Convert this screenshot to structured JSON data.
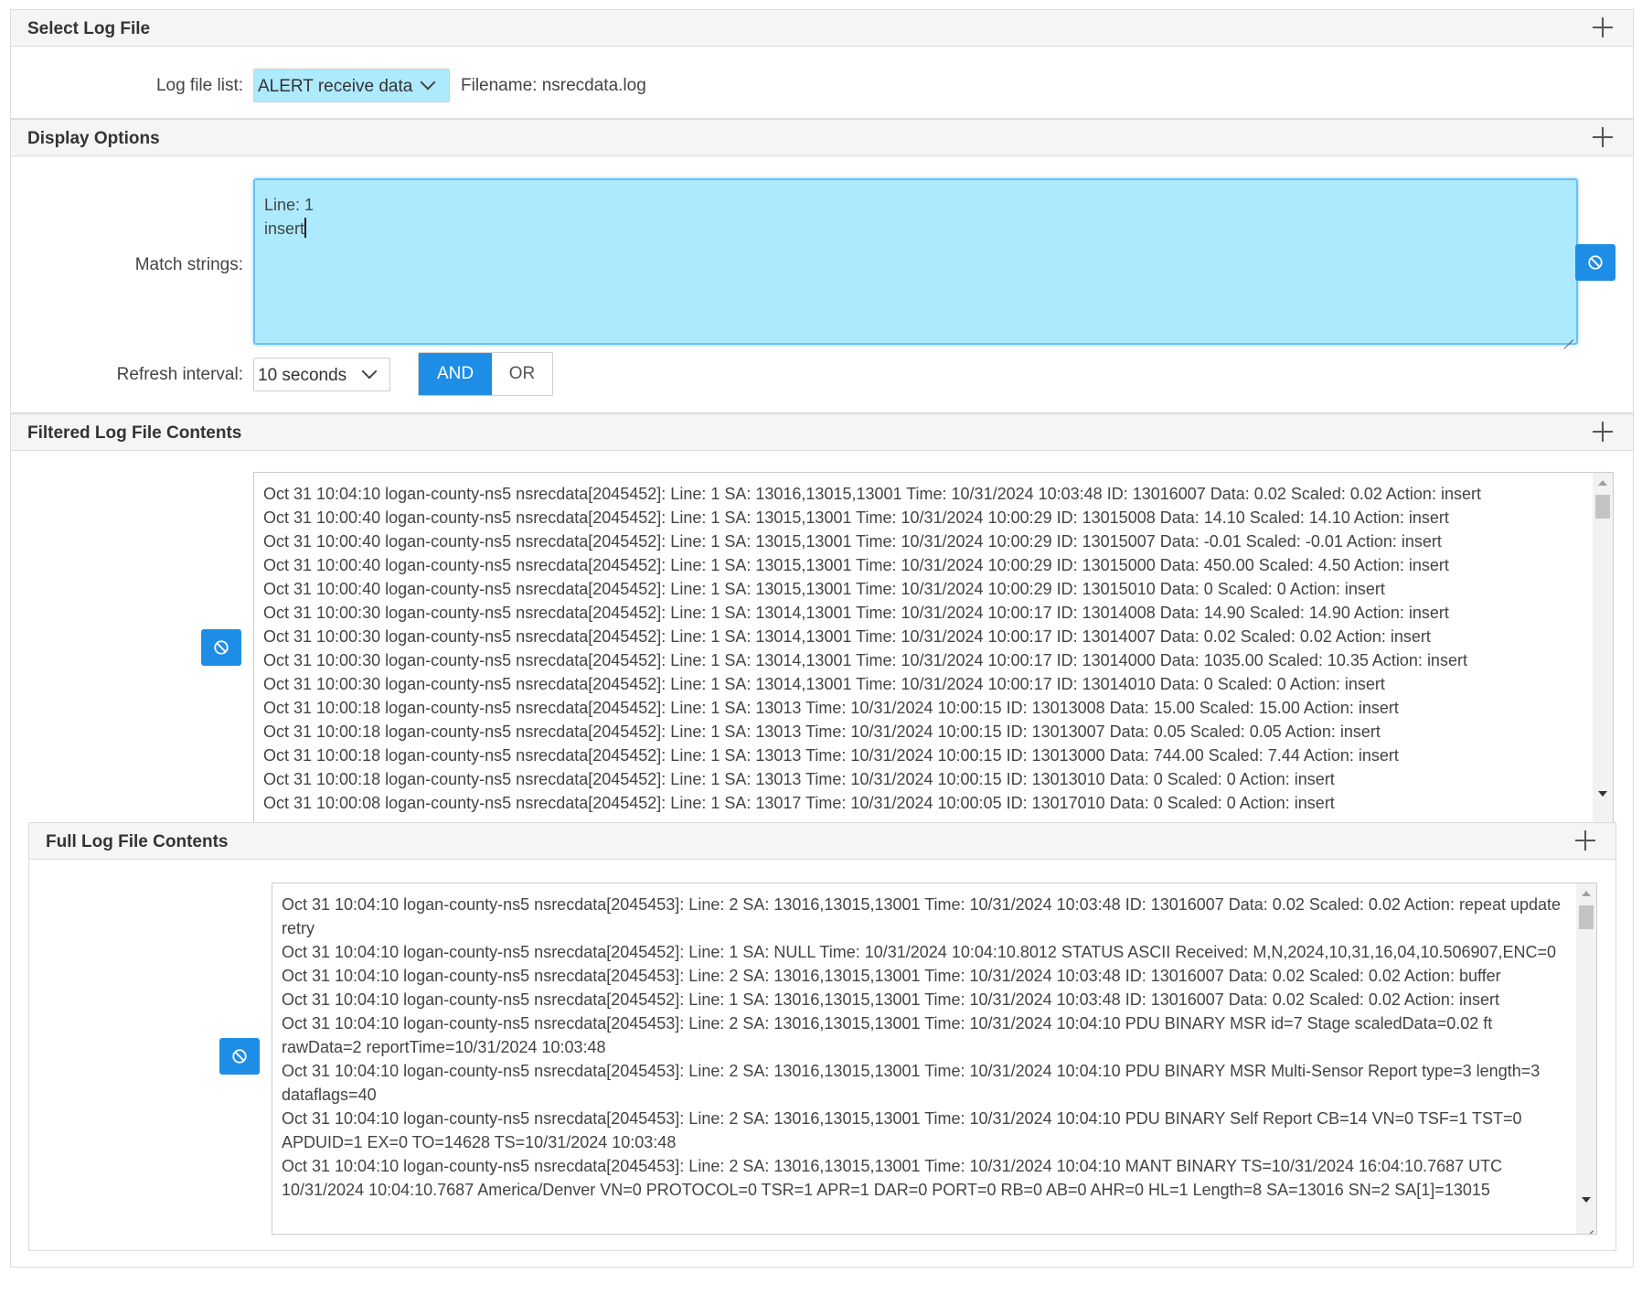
{
  "select_panel": {
    "title": "Select Log File",
    "log_file_label": "Log file list:",
    "log_file_value": "ALERT receive data",
    "filename_text": "Filename: nsrecdata.log"
  },
  "display_panel": {
    "title": "Display Options",
    "match_label": "Match strings:",
    "match_lines": [
      "Line: 1",
      "insert"
    ],
    "refresh_label": "Refresh interval:",
    "refresh_value": "10 seconds",
    "and_label": "AND",
    "or_label": "OR",
    "active_mode": "AND"
  },
  "filtered_panel": {
    "title": "Filtered Log File Contents",
    "lines": [
      "Oct 31 10:04:10 logan-county-ns5 nsrecdata[2045452]: Line: 1 SA: 13016,13015,13001 Time: 10/31/2024 10:03:48 ID: 13016007 Data: 0.02 Scaled: 0.02 Action: insert",
      "Oct 31 10:00:40 logan-county-ns5 nsrecdata[2045452]: Line: 1 SA: 13015,13001 Time: 10/31/2024 10:00:29 ID: 13015008 Data: 14.10 Scaled: 14.10 Action: insert",
      "Oct 31 10:00:40 logan-county-ns5 nsrecdata[2045452]: Line: 1 SA: 13015,13001 Time: 10/31/2024 10:00:29 ID: 13015007 Data: -0.01 Scaled: -0.01 Action: insert",
      "Oct 31 10:00:40 logan-county-ns5 nsrecdata[2045452]: Line: 1 SA: 13015,13001 Time: 10/31/2024 10:00:29 ID: 13015000 Data: 450.00 Scaled: 4.50 Action: insert",
      "Oct 31 10:00:40 logan-county-ns5 nsrecdata[2045452]: Line: 1 SA: 13015,13001 Time: 10/31/2024 10:00:29 ID: 13015010 Data: 0 Scaled: 0 Action: insert",
      "Oct 31 10:00:30 logan-county-ns5 nsrecdata[2045452]: Line: 1 SA: 13014,13001 Time: 10/31/2024 10:00:17 ID: 13014008 Data: 14.90 Scaled: 14.90 Action: insert",
      "Oct 31 10:00:30 logan-county-ns5 nsrecdata[2045452]: Line: 1 SA: 13014,13001 Time: 10/31/2024 10:00:17 ID: 13014007 Data: 0.02 Scaled: 0.02 Action: insert",
      "Oct 31 10:00:30 logan-county-ns5 nsrecdata[2045452]: Line: 1 SA: 13014,13001 Time: 10/31/2024 10:00:17 ID: 13014000 Data: 1035.00 Scaled: 10.35 Action: insert",
      "Oct 31 10:00:30 logan-county-ns5 nsrecdata[2045452]: Line: 1 SA: 13014,13001 Time: 10/31/2024 10:00:17 ID: 13014010 Data: 0 Scaled: 0 Action: insert",
      "Oct 31 10:00:18 logan-county-ns5 nsrecdata[2045452]: Line: 1 SA: 13013 Time: 10/31/2024 10:00:15 ID: 13013008 Data: 15.00 Scaled: 15.00 Action: insert",
      "Oct 31 10:00:18 logan-county-ns5 nsrecdata[2045452]: Line: 1 SA: 13013 Time: 10/31/2024 10:00:15 ID: 13013007 Data: 0.05 Scaled: 0.05 Action: insert",
      "Oct 31 10:00:18 logan-county-ns5 nsrecdata[2045452]: Line: 1 SA: 13013 Time: 10/31/2024 10:00:15 ID: 13013000 Data: 744.00 Scaled: 7.44 Action: insert",
      "Oct 31 10:00:18 logan-county-ns5 nsrecdata[2045452]: Line: 1 SA: 13013 Time: 10/31/2024 10:00:15 ID: 13013010 Data: 0 Scaled: 0 Action: insert",
      "Oct 31 10:00:08 logan-county-ns5 nsrecdata[2045452]: Line: 1 SA: 13017 Time: 10/31/2024 10:00:05 ID: 13017010 Data: 0 Scaled: 0 Action: insert"
    ]
  },
  "full_panel": {
    "title": "Full Log File Contents",
    "lines": [
      "Oct 31 10:04:10 logan-county-ns5 nsrecdata[2045453]: Line: 2 SA: 13016,13015,13001 Time: 10/31/2024 10:03:48 ID: 13016007 Data: 0.02 Scaled: 0.02 Action: repeat update retry",
      "Oct 31 10:04:10 logan-county-ns5 nsrecdata[2045452]: Line: 1 SA: NULL Time: 10/31/2024 10:04:10.8012 STATUS ASCII Received: M,N,2024,10,31,16,04,10.506907,ENC=0",
      "Oct 31 10:04:10 logan-county-ns5 nsrecdata[2045453]: Line: 2 SA: 13016,13015,13001 Time: 10/31/2024 10:03:48 ID: 13016007 Data: 0.02 Scaled: 0.02 Action: buffer",
      "Oct 31 10:04:10 logan-county-ns5 nsrecdata[2045452]: Line: 1 SA: 13016,13015,13001 Time: 10/31/2024 10:03:48 ID: 13016007 Data: 0.02 Scaled: 0.02 Action: insert",
      "Oct 31 10:04:10 logan-county-ns5 nsrecdata[2045453]: Line: 2 SA: 13016,13015,13001 Time: 10/31/2024 10:04:10 PDU BINARY MSR id=7 Stage scaledData=0.02 ft rawData=2 reportTime=10/31/2024 10:03:48",
      "Oct 31 10:04:10 logan-county-ns5 nsrecdata[2045453]: Line: 2 SA: 13016,13015,13001 Time: 10/31/2024 10:04:10 PDU BINARY MSR Multi-Sensor Report type=3 length=3 dataflags=40",
      "Oct 31 10:04:10 logan-county-ns5 nsrecdata[2045453]: Line: 2 SA: 13016,13015,13001 Time: 10/31/2024 10:04:10 PDU BINARY Self Report CB=14 VN=0 TSF=1 TST=0 APDUID=1 EX=0 TO=14628 TS=10/31/2024 10:03:48",
      "Oct 31 10:04:10 logan-county-ns5 nsrecdata[2045453]: Line: 2 SA: 13016,13015,13001 Time: 10/31/2024 10:04:10 MANT BINARY TS=10/31/2024 16:04:10.7687 UTC 10/31/2024 10:04:10.7687 America/Denver VN=0 PROTOCOL=0 TSR=1 APR=1 DAR=0 PORT=0 RB=0 AB=0 AHR=0 HL=1 Length=8 SA=13016 SN=2 SA[1]=13015"
    ]
  },
  "colors": {
    "accent": "#1e8de6",
    "input_bg": "#aeeafd",
    "header_bg": "#f5f5f5"
  },
  "icons": {
    "expand": "plus-icon",
    "clear": "ban-icon",
    "dropdown": "chevron-down-icon"
  }
}
